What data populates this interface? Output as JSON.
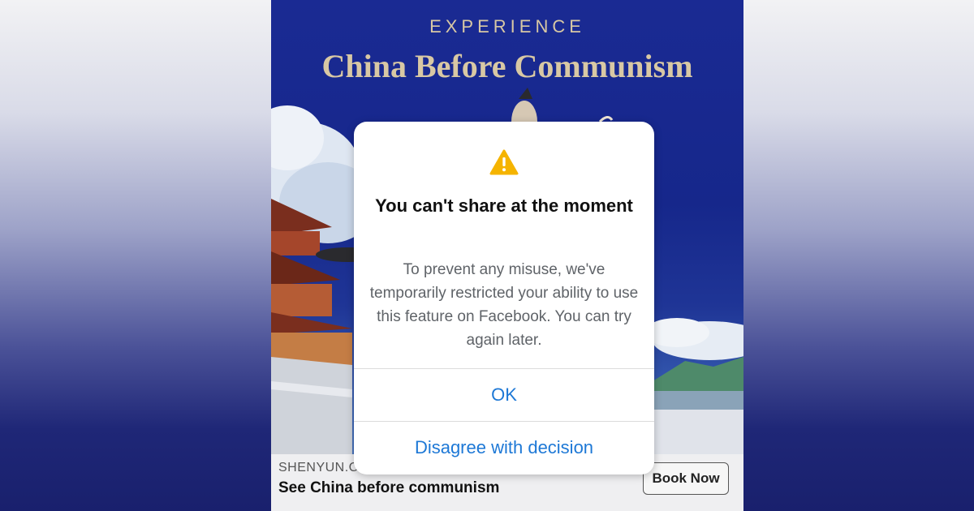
{
  "ad": {
    "eyebrow": "EXPERIENCE",
    "title": "China Before Communism",
    "domain": "SHENYUN.C",
    "tagline": "See China before communism",
    "cta_label": "Book Now"
  },
  "dialog": {
    "icon": "warning-icon",
    "title": "You can't share at the moment",
    "message": "To prevent any misuse, we've temporarily restricted your ability to use this feature on Facebook. You can try again later.",
    "ok_label": "OK",
    "disagree_label": "Disagree with decision"
  },
  "colors": {
    "ad_background": "#16278b",
    "ad_title": "#d8c8a4",
    "warning": "#f5b400",
    "button_text": "#1d78d6"
  }
}
